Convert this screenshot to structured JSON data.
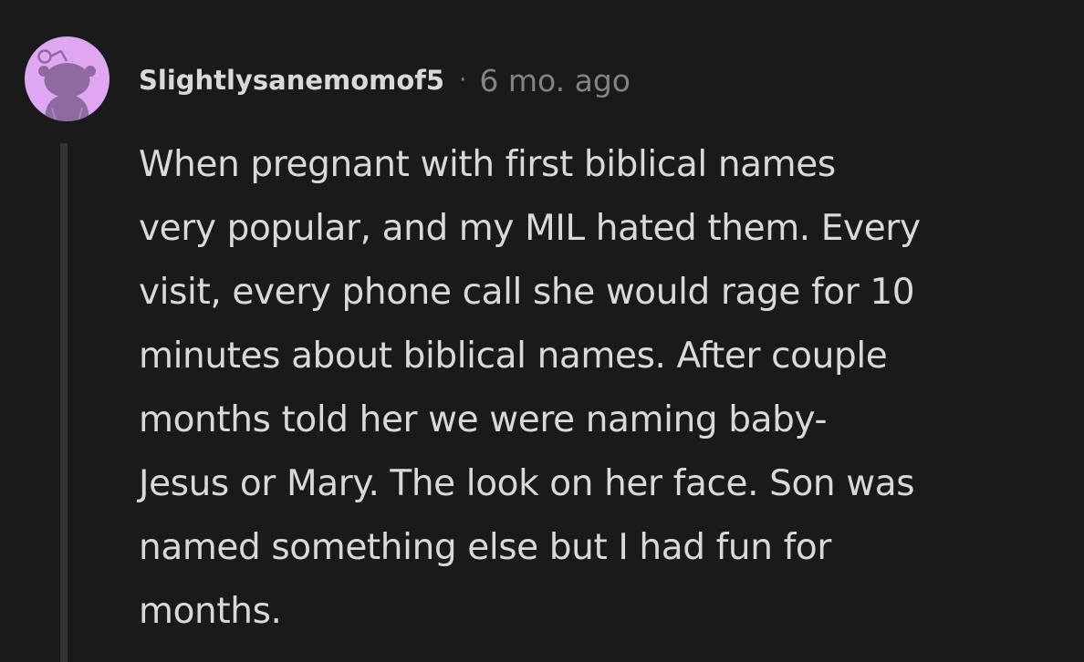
{
  "comment": {
    "avatar_icon": "reddit-snoo-avatar-icon",
    "avatar_color": "#dfa7f2",
    "username": "Slightlysanemomof5",
    "separator": "·",
    "timestamp": "6 mo. ago",
    "body_lines": [
      "When pregnant with first biblical names",
      "very popular, and my MIL hated them. Every",
      "visit, every phone call she would rage for 10",
      "minutes about biblical names. After couple",
      "months told her we were naming baby-",
      "Jesus or Mary. The look on her face. Son was",
      "named something else but I had fun for",
      "months."
    ]
  },
  "colors": {
    "background": "#1a1a1b",
    "text": "#d7dadc",
    "meta_text": "#818384",
    "thread_line": "#343536"
  }
}
